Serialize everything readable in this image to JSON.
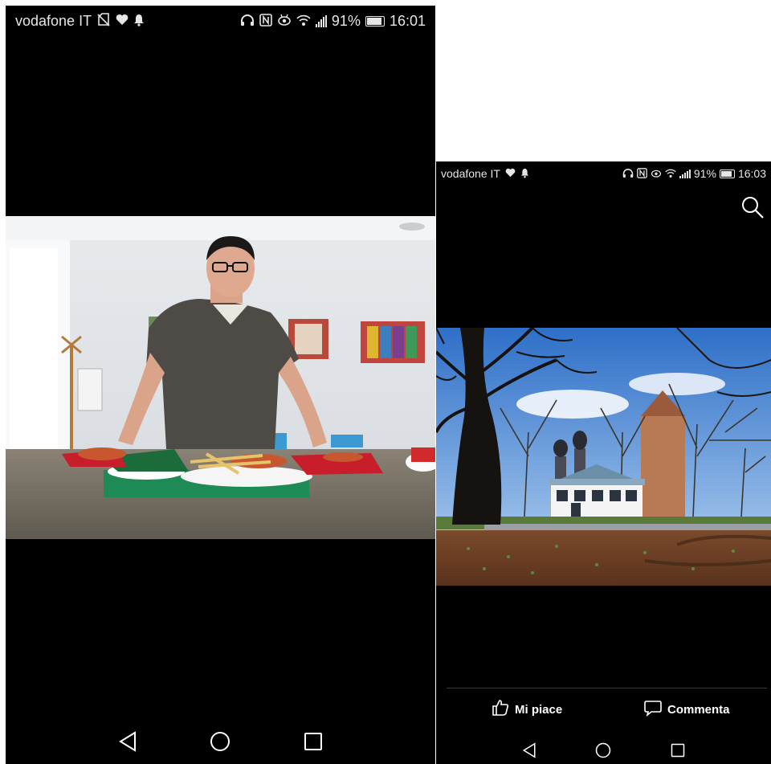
{
  "left_phone": {
    "status": {
      "carrier": "vodafone IT",
      "battery_percent": "91%",
      "battery_level": 0.91,
      "time": "16:01"
    },
    "photo": {
      "subject": "man leaning on a table with food"
    },
    "navbar": [
      "back-icon",
      "home-icon",
      "recents-icon"
    ]
  },
  "right_phone": {
    "status": {
      "carrier": "vodafone IT",
      "battery_percent": "91%",
      "battery_level": 0.91,
      "time": "16:03"
    },
    "search_icon": "search-icon",
    "photo": {
      "subject": "park pavilion with bare trees"
    },
    "actions": {
      "like_label": "Mi piace",
      "comment_label": "Commenta"
    },
    "navbar": [
      "back-icon",
      "home-icon",
      "recents-icon"
    ]
  },
  "colors": {
    "background": "#000000",
    "status_text": "#e6e6e6",
    "divider": "#3a3a3a"
  }
}
